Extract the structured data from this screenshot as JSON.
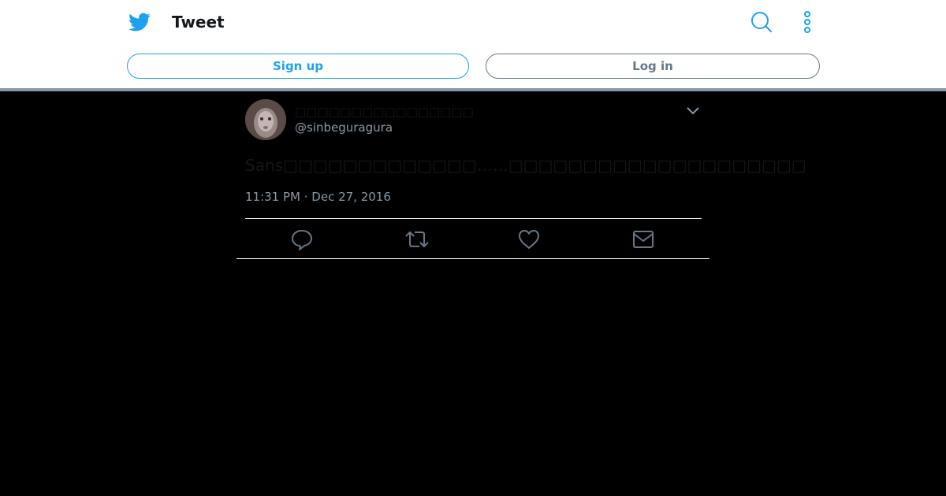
{
  "header": {
    "title": "Tweet",
    "signup_label": "Sign up",
    "login_label": "Log in"
  },
  "tweet": {
    "display_name": "□□□□□□□□□□□□□□□□",
    "handle": "@sinbeguragura",
    "text": "Sans□□□□□□□□□□□□□……□□□□□□□□□□□□□□□□□□□□",
    "timestamp": "11:31 PM · Dec 27, 2016"
  },
  "icons": {
    "logo": "twitter-bird-icon",
    "search": "search-icon",
    "more": "more-vertical-icon",
    "caret": "chevron-down-icon",
    "reply": "reply-icon",
    "retweet": "retweet-icon",
    "like": "heart-icon",
    "dm": "mail-icon"
  },
  "colors": {
    "brand": "#1da1f2",
    "secondary": "#657786",
    "muted": "#8899a6",
    "background": "#000000"
  }
}
